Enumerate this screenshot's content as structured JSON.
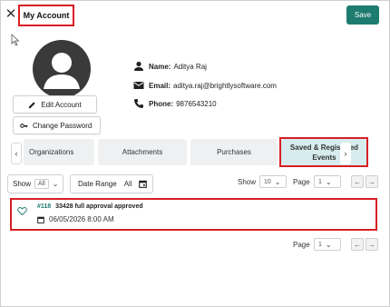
{
  "header": {
    "title": "My Account",
    "save_label": "Save"
  },
  "profile": {
    "edit_label": "Edit Account",
    "change_password_label": "Change Password",
    "name_label": "Name:",
    "name_value": "Aditya Raj",
    "email_label": "Email:",
    "email_value": "aditya.raj@brightlysoftware.com",
    "phone_label": "Phone:",
    "phone_value": "9876543210"
  },
  "tabs": [
    {
      "label": "Organizations"
    },
    {
      "label": "Attachments"
    },
    {
      "label": "Purchases"
    },
    {
      "label": "Saved & Registered Events",
      "active": true
    }
  ],
  "filters": {
    "show_label": "Show",
    "show_value": "All",
    "date_range_label": "Date Range",
    "date_range_value": "All",
    "page_size_label": "Show",
    "page_size_value": "10",
    "page_label": "Page",
    "page_value": "1"
  },
  "items": [
    {
      "id": "#118",
      "title": "33428 full approval approved",
      "date": "06/05/2026 8:00 AM",
      "favorited": false
    }
  ],
  "footer": {
    "page_label": "Page",
    "page_value": "1"
  },
  "colors": {
    "accent": "#1e7b6f",
    "highlight_outline": "#d81e24",
    "active_tab": "#d7ecef"
  }
}
